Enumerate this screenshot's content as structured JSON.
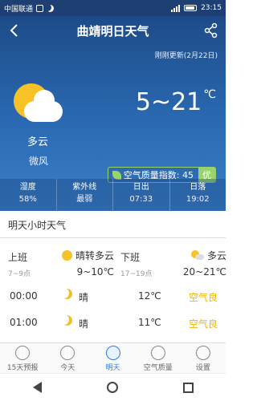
{
  "status_bar": {
    "carrier": "中国联通",
    "time": "23:15"
  },
  "header": {
    "title": "曲靖明日天气",
    "updated": "刚刚更新(2月22日)"
  },
  "current": {
    "condition": "多云",
    "wind": "微风",
    "temperature": "5~21",
    "temperature_unit": "℃",
    "aqi_label": "空气质量指数: 45",
    "aqi_level": "优"
  },
  "stats": [
    {
      "label": "湿度",
      "value": "58%"
    },
    {
      "label": "紫外线",
      "value": "最弱"
    },
    {
      "label": "日出",
      "value": "07:33"
    },
    {
      "label": "日落",
      "value": "19:02"
    }
  ],
  "section_title": "明天小时天气",
  "commute": [
    {
      "name": "上班",
      "time": "7~9点",
      "condition": "晴转多云",
      "range": "9~10℃",
      "icon": "sun-icon"
    },
    {
      "name": "下班",
      "time": "17~19点",
      "condition": "多云",
      "range": "20~21℃",
      "icon": "partly-cloudy-icon"
    }
  ],
  "hours": [
    {
      "hour": "00:00",
      "weather": "晴",
      "temp": "12℃",
      "air": "空气良"
    },
    {
      "hour": "01:00",
      "weather": "晴",
      "temp": "11℃",
      "air": "空气良"
    }
  ],
  "tabs": [
    {
      "label": "15天预报",
      "icon": "sun-outline-icon"
    },
    {
      "label": "今天",
      "icon": "today-icon"
    },
    {
      "label": "明天",
      "icon": "tomorrow-icon"
    },
    {
      "label": "空气质量",
      "icon": "leaf-icon"
    },
    {
      "label": "设置",
      "icon": "gear-icon"
    }
  ],
  "colors": {
    "accent": "#2f7ee0",
    "good_air": "#9ad36e",
    "air_text": "#f0b400"
  }
}
